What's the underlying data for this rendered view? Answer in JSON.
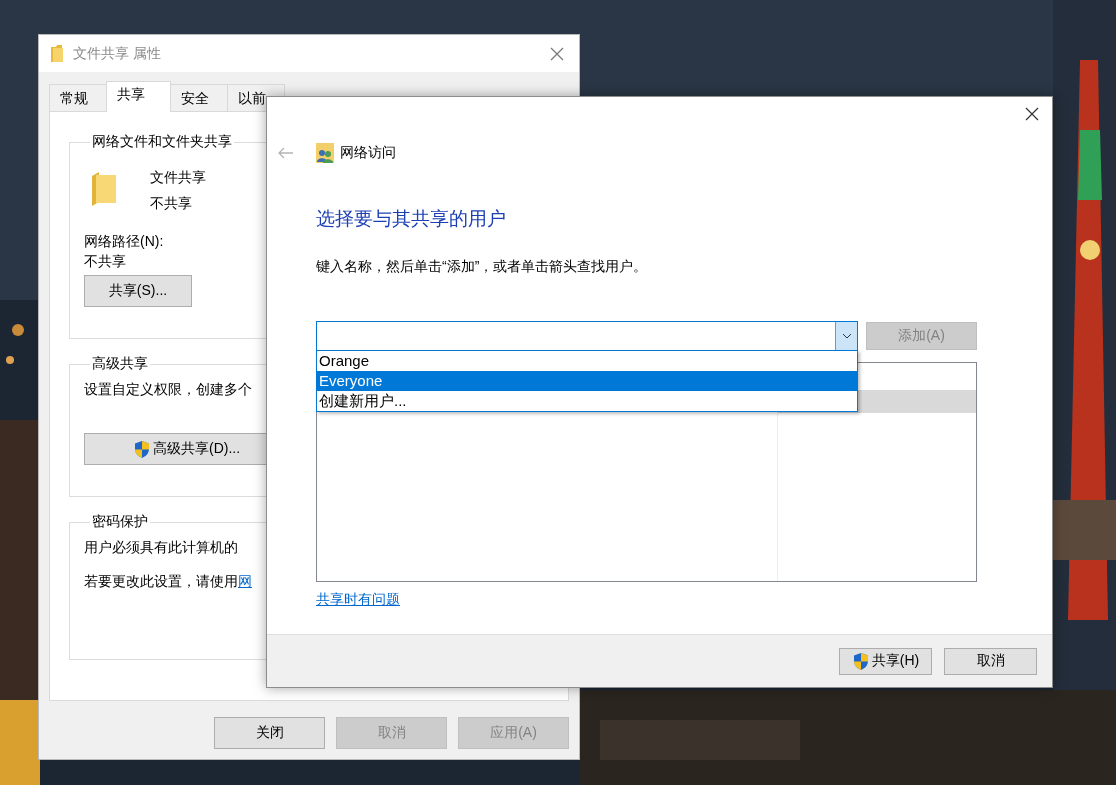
{
  "properties_window": {
    "title": "文件共享 属性",
    "tabs": [
      {
        "label": "常规",
        "selected": false
      },
      {
        "label": "共享",
        "selected": true
      },
      {
        "label": "安全",
        "selected": false
      },
      {
        "label": "以前",
        "selected": false
      }
    ],
    "sharing_group": {
      "title": "网络文件和文件夹共享",
      "item_name": "文件共享",
      "item_status": "不共享",
      "path_label": "网络路径(N):",
      "path_value": "不共享",
      "button": "共享(S)..."
    },
    "advanced_group": {
      "title": "高级共享",
      "description": "设置自定义权限，创建多个",
      "button": "高级共享(D)..."
    },
    "password_group": {
      "title": "密码保护",
      "line_1": "用户必须具有此计算机的",
      "line_2": "若要更改此设置，请使用",
      "link": "网"
    },
    "buttons": [
      {
        "label": "关闭",
        "disabled": false
      },
      {
        "label": "取消",
        "disabled": true
      },
      {
        "label": "应用(A)",
        "disabled": true
      }
    ]
  },
  "share_dialog": {
    "nav_title": "网络访问",
    "back_disabled": true,
    "heading": "选择要与其共享的用户",
    "instruction": "键入名称，然后单击“添加”，或者单击箭头查找用户。",
    "name_field": {
      "expanded": true,
      "options": [
        {
          "label": "Orange",
          "selected": false
        },
        {
          "label": "Everyone",
          "selected": true
        },
        {
          "label": "创建新用户...",
          "selected": false
        }
      ]
    },
    "add_button": {
      "label": "添加(A)",
      "disabled": true
    },
    "user_list": {
      "rows": [
        {
          "selected": false
        },
        {
          "selected": true
        }
      ]
    },
    "help_link": "共享时有问题",
    "buttons": [
      {
        "label": "共享(H)",
        "shield": true,
        "disabled": false
      },
      {
        "label": "取消",
        "shield": false,
        "disabled": false
      }
    ]
  }
}
